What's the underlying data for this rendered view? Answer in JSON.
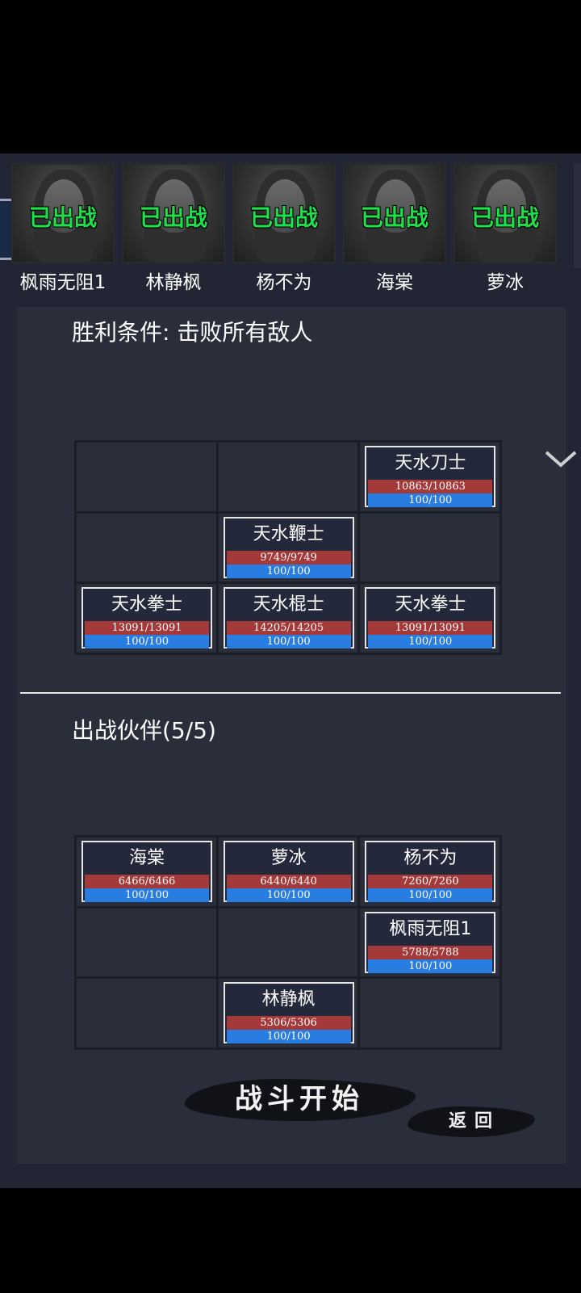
{
  "roster": {
    "deployed_label": "已出战",
    "heroes": [
      {
        "name": "枫雨无阻1"
      },
      {
        "name": "林静枫"
      },
      {
        "name": "杨不为"
      },
      {
        "name": "海棠"
      },
      {
        "name": "萝冰"
      }
    ]
  },
  "victory": {
    "title": "胜利条件: 击败所有敌人"
  },
  "enemy_grid": {
    "cells": [
      null,
      null,
      {
        "name": "天水刀士",
        "hp": "10863/10863",
        "mp": "100/100"
      },
      null,
      {
        "name": "天水鞭士",
        "hp": "9749/9749",
        "mp": "100/100"
      },
      null,
      {
        "name": "天水拳士",
        "hp": "13091/13091",
        "mp": "100/100"
      },
      {
        "name": "天水棍士",
        "hp": "14205/14205",
        "mp": "100/100"
      },
      {
        "name": "天水拳士",
        "hp": "13091/13091",
        "mp": "100/100"
      }
    ]
  },
  "partners": {
    "title": "出战伙伴(5/5)",
    "cells": [
      {
        "name": "海棠",
        "hp": "6466/6466",
        "mp": "100/100"
      },
      {
        "name": "萝冰",
        "hp": "6440/6440",
        "mp": "100/100"
      },
      {
        "name": "杨不为",
        "hp": "7260/7260",
        "mp": "100/100"
      },
      null,
      null,
      {
        "name": "枫雨无阻1",
        "hp": "5788/5788",
        "mp": "100/100"
      },
      null,
      {
        "name": "林静枫",
        "hp": "5306/5306",
        "mp": "100/100"
      },
      null
    ]
  },
  "actions": {
    "start_label": "战斗开始",
    "back_label": "返回"
  },
  "colors": {
    "deployed_text": "#1fe04a",
    "hp_bar": "#a43939",
    "mp_bar": "#2a7de0",
    "panel": "#2a2e3b"
  }
}
